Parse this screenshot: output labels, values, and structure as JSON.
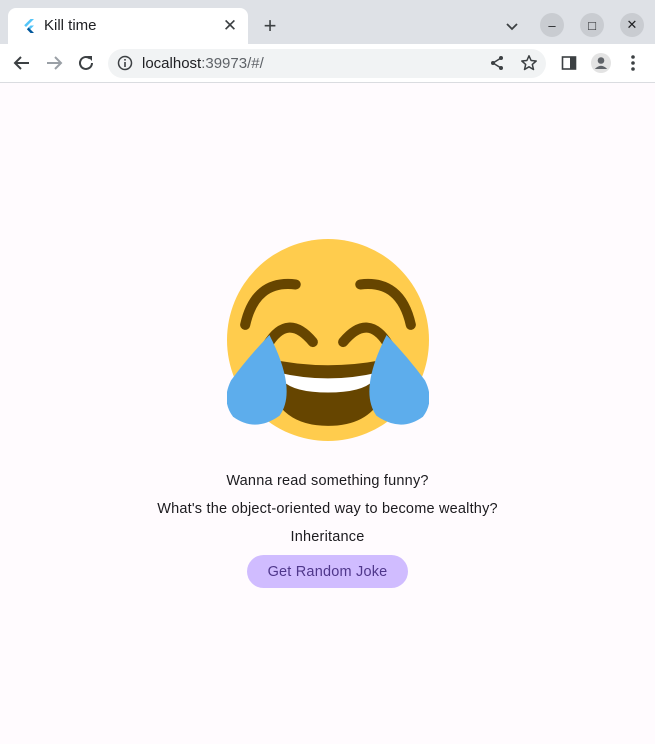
{
  "browser": {
    "tab": {
      "title": "Kill time",
      "favicon": "flutter-icon"
    },
    "window_controls": {
      "minimize": "–",
      "maximize": "□",
      "close": "✕"
    },
    "address": {
      "host": "localhost",
      "rest": ":39973/#/"
    }
  },
  "page": {
    "emoji": "face-with-tears-of-joy",
    "prompt": "Wanna read something funny?",
    "setup": "What's the object-oriented way to become wealthy?",
    "punchline": "Inheritance",
    "button_label": "Get Random Joke"
  },
  "colors": {
    "emoji_face": "#ffcc4d",
    "emoji_features": "#664500",
    "emoji_tears": "#5dadec",
    "button_bg": "#d0bcff",
    "button_text": "#4f378b",
    "page_bg": "#fffbfe"
  }
}
